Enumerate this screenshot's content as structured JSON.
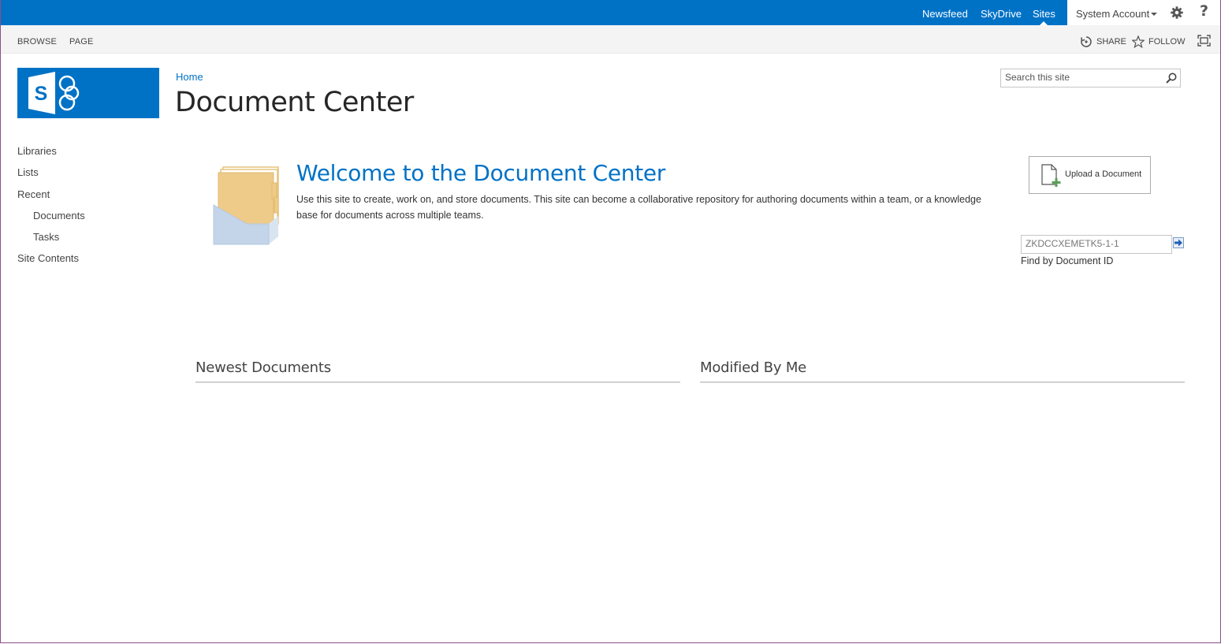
{
  "suitebar": {
    "links": [
      "Newsfeed",
      "SkyDrive",
      "Sites"
    ],
    "active_link": "Sites",
    "account_name": "System Account",
    "help_label": "?"
  },
  "ribbon": {
    "tabs": [
      "BROWSE",
      "PAGE"
    ],
    "share_label": "SHARE",
    "follow_label": "FOLLOW"
  },
  "header": {
    "breadcrumb_home": "Home",
    "site_title": "Document Center",
    "search_placeholder": "Search this site"
  },
  "left_nav": {
    "items": [
      "Libraries",
      "Lists",
      "Recent",
      "Documents",
      "Tasks",
      "Site Contents"
    ]
  },
  "welcome": {
    "title": "Welcome to the Document Center",
    "description": "Use this site to create, work on, and store documents. This site can become a collaborative repository for authoring documents within a team, or a knowledge base for documents across multiple teams."
  },
  "upload": {
    "label": "Upload a Document"
  },
  "find_by_id": {
    "value": "ZKDCCXEMETK5-1-1",
    "label": "Find by Document ID"
  },
  "webparts": {
    "newest_title": "Newest Documents",
    "modified_title": "Modified By Me"
  },
  "colors": {
    "suitebar": "#0072c6",
    "accent": "#0072c6",
    "ribbon": "#f4f4f4"
  },
  "icons": [
    "share-icon",
    "follow-star-icon",
    "focus-icon",
    "gear-icon",
    "search-icon",
    "upload-document-icon",
    "go-arrow-icon",
    "sharepoint-logo"
  ]
}
